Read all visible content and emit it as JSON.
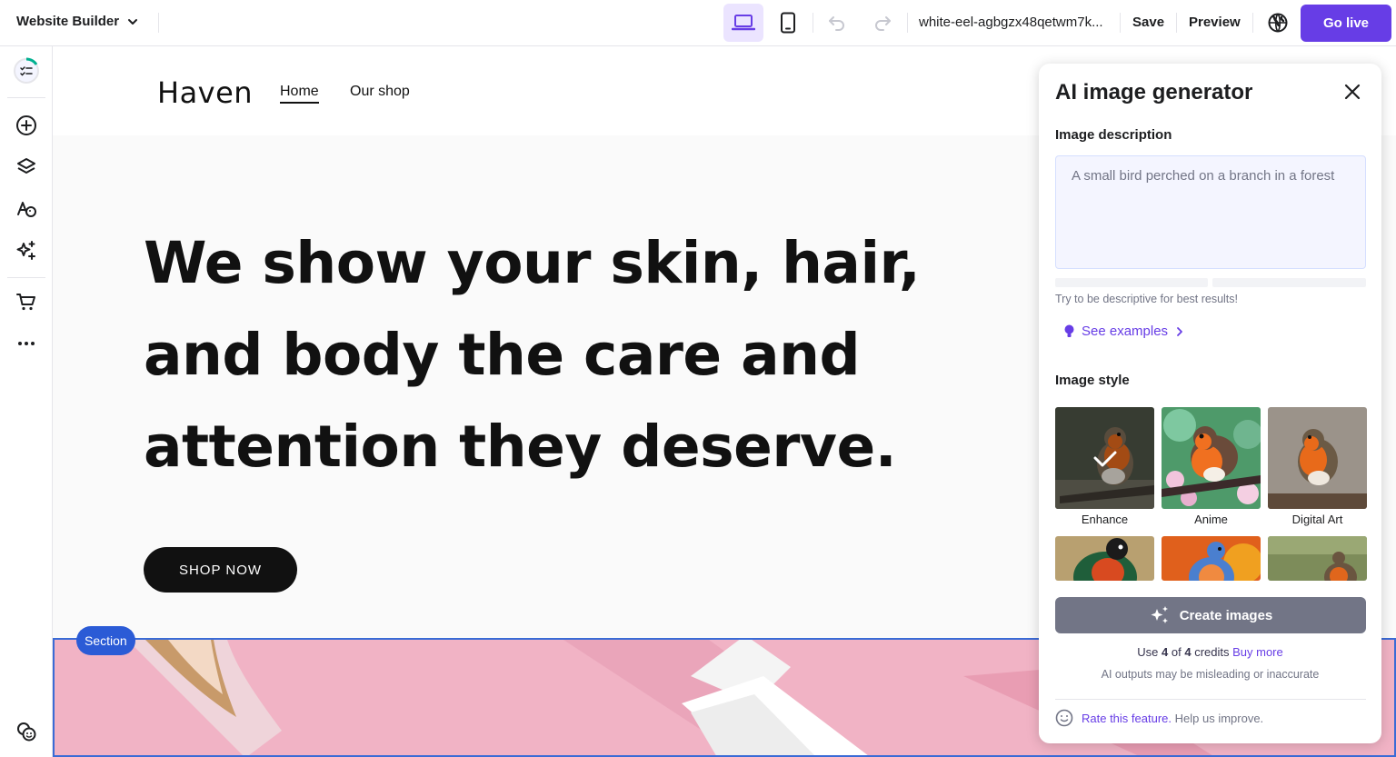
{
  "topbar": {
    "app_title": "Website Builder",
    "domain": "white-eel-agbgzx48qetwm7k...",
    "save_label": "Save",
    "preview_label": "Preview",
    "go_live_label": "Go live"
  },
  "colors": {
    "accent": "#673de6",
    "section_outline": "#2b5bd6",
    "banner_pink": "#f1b3c5"
  },
  "sidebar": {
    "items": [
      "checklist-progress-icon",
      "add-element-icon",
      "layers-icon",
      "styles-icon",
      "ai-tools-icon",
      "store-cart-icon",
      "more-icon",
      "help-icon"
    ]
  },
  "site": {
    "logo": "Haven",
    "nav": [
      "Home",
      "Our shop"
    ],
    "hero_title": "We show your skin, hair, and body the care and attention they deserve.",
    "cta_label": "SHOP NOW",
    "section_badge": "Section"
  },
  "ai_panel": {
    "title": "AI image generator",
    "description_label": "Image description",
    "description_placeholder": "A small bird perched on a branch in a forest",
    "hint": "Try to be descriptive for best results!",
    "examples_link": "See examples",
    "style_label": "Image style",
    "styles": [
      {
        "label": "Enhance",
        "selected": true
      },
      {
        "label": "Anime",
        "selected": false
      },
      {
        "label": "Digital Art",
        "selected": false
      }
    ],
    "create_label": "Create images",
    "credits_prefix": "Use",
    "credits_used": "4",
    "credits_of": "of",
    "credits_total": "4",
    "credits_suffix": "credits",
    "buy_more": "Buy more",
    "disclaimer": "AI outputs may be misleading or inaccurate",
    "rate_link": "Rate this feature.",
    "rate_suffix": "Help us improve."
  }
}
